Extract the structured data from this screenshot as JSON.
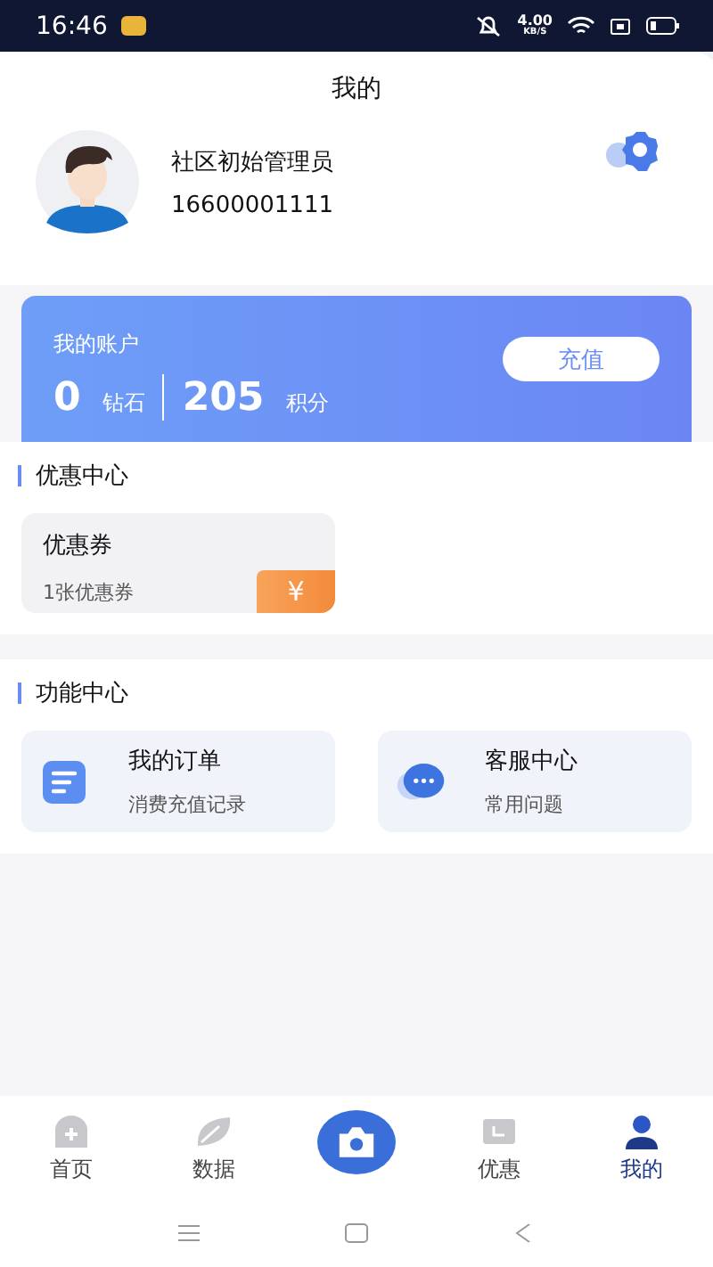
{
  "status_bar": {
    "time": "16:46",
    "speed": "4.00",
    "speed_unit": "KB/S"
  },
  "header": {
    "title": "我的"
  },
  "profile": {
    "name": "社区初始管理员",
    "phone": "16600001111"
  },
  "account": {
    "title": "我的账户",
    "stats": [
      {
        "value": "0",
        "unit": "钻石"
      },
      {
        "value": "205",
        "unit": "积分"
      }
    ],
    "button": "充值"
  },
  "sections": [
    {
      "title": "优惠中心",
      "kind": "coupon",
      "cards": [
        {
          "title": "优惠券",
          "subtitle": "1张优惠券",
          "badge": "¥"
        }
      ]
    },
    {
      "title": "功能中心",
      "kind": "feature",
      "cards": [
        {
          "title": "我的订单",
          "subtitle": "消费充值记录",
          "kind": "document"
        },
        {
          "title": "客服中心",
          "subtitle": "常用问题",
          "kind": "chat"
        }
      ]
    }
  ],
  "tab_bar": [
    {
      "label": "首页",
      "kind": "home",
      "selected": false
    },
    {
      "label": "数据",
      "kind": "data",
      "selected": false
    },
    {
      "kind": "camera"
    },
    {
      "label": "优惠",
      "kind": "coupon",
      "selected": false
    },
    {
      "label": "我的",
      "kind": "me",
      "selected": true
    }
  ]
}
